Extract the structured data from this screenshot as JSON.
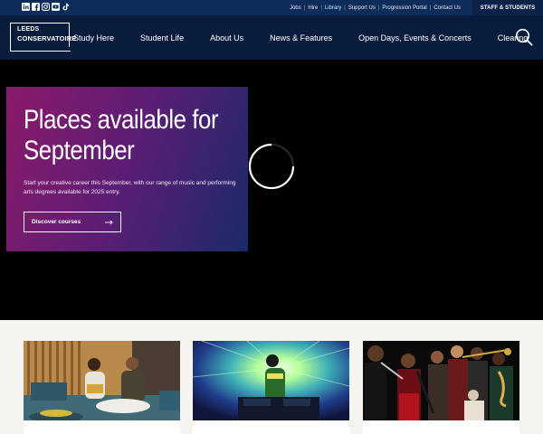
{
  "utility_bar": {
    "social_icons": [
      {
        "name": "linkedin-icon",
        "glyph": "in"
      },
      {
        "name": "facebook-icon",
        "glyph": "f"
      },
      {
        "name": "instagram-icon",
        "glyph": "◎"
      },
      {
        "name": "youtube-icon",
        "glyph": "▶"
      },
      {
        "name": "tiktok-icon",
        "glyph": "♪"
      }
    ],
    "links": [
      "Jobs",
      "Hire",
      "Library",
      "Support Us",
      "Progression Portal",
      "Contact Us"
    ],
    "staff_label": "STAFF & STUDENTS"
  },
  "header": {
    "logo_line1": "LEEDS",
    "logo_line2": "CONSERVATOIRE",
    "nav": [
      "Study Here",
      "Student Life",
      "About Us",
      "News & Features",
      "Open Days, Events & Concerts",
      "Clearing"
    ],
    "search_icon": "search-icon"
  },
  "hero": {
    "title_line1": "Places available for",
    "title_line2": "September",
    "body": "Start your creative career this September, with our range of music and performing arts degrees available for 2025 entry.",
    "cta_label": "Discover courses",
    "cta_icon": "arrow-right-icon"
  },
  "colors": {
    "utility_bg": "#0e2c5a",
    "header_bg": "#0a1c3d",
    "hero_gradient_start": "#8c1a6a",
    "hero_gradient_end": "#1a2a6a",
    "page_bg": "#f5f4ef"
  }
}
